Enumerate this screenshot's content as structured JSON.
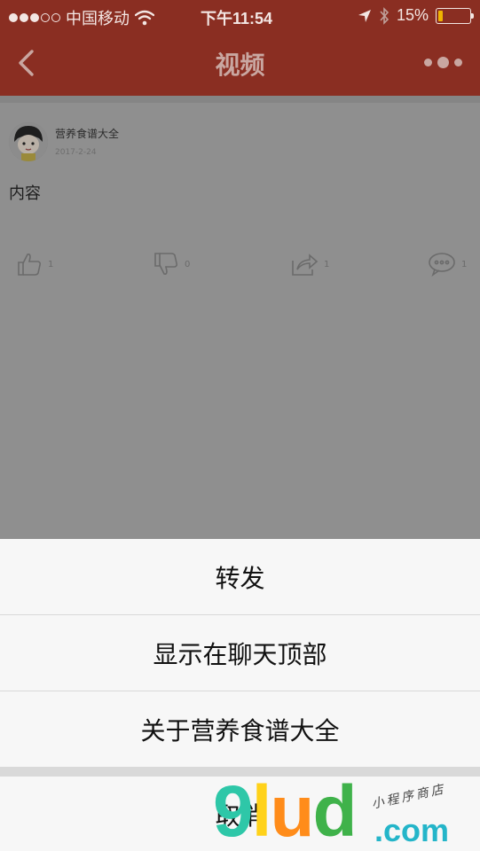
{
  "status_bar": {
    "carrier": "中国移动",
    "time": "下午11:54",
    "battery_percent": "15%",
    "battery_level": 0.15,
    "signal_bars_filled": 3,
    "signal_bars_total": 5
  },
  "nav": {
    "title": "视频",
    "back_icon": "chevron-left-icon",
    "more_icon": "more-dots-icon"
  },
  "post": {
    "account_name": "营养食谱大全",
    "date": "2017-2-24",
    "body": "内容",
    "actions": [
      {
        "icon": "thumbs-up-icon",
        "count": "1"
      },
      {
        "icon": "thumbs-down-icon",
        "count": "0"
      },
      {
        "icon": "share-icon",
        "count": "1"
      },
      {
        "icon": "comment-icon",
        "count": "1"
      }
    ]
  },
  "action_sheet": {
    "items": [
      {
        "label": "转发"
      },
      {
        "label": "显示在聊天顶部"
      },
      {
        "label": "关于营养食谱大全"
      }
    ],
    "cancel_label": "取消"
  },
  "watermark": {
    "brand": "9lud",
    "domain": ".com",
    "tagline": "小程序商店"
  },
  "colors": {
    "brand_red": "#8a2e22",
    "overlay_gray": "#8f8f8f",
    "sheet_bg": "#f7f7f7"
  }
}
